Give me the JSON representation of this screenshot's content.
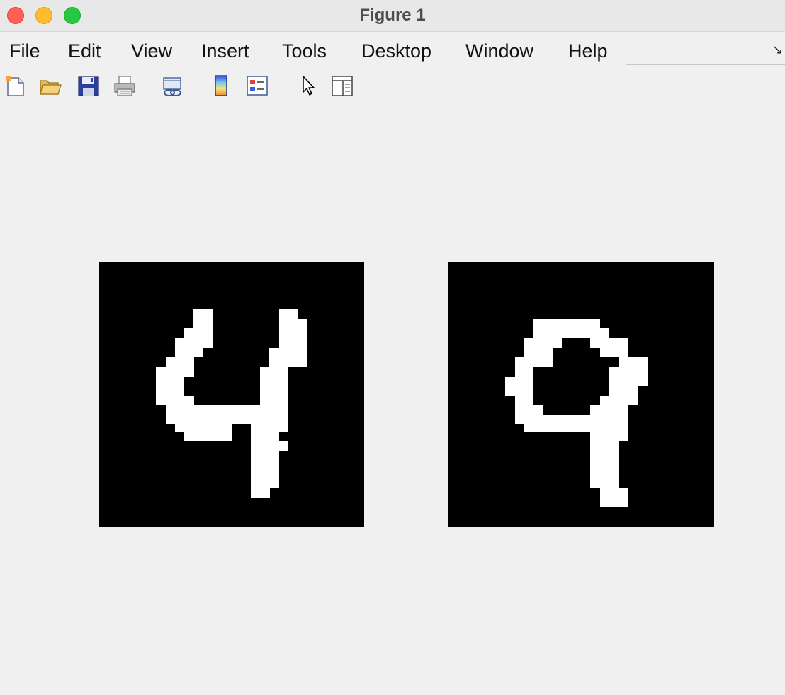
{
  "window": {
    "title": "Figure 1"
  },
  "menubar": {
    "items": [
      {
        "label": "File"
      },
      {
        "label": "Edit"
      },
      {
        "label": "View"
      },
      {
        "label": "Insert"
      },
      {
        "label": "Tools"
      },
      {
        "label": "Desktop"
      },
      {
        "label": "Window"
      },
      {
        "label": "Help"
      }
    ]
  },
  "toolbar": {
    "icons": [
      "new-figure-icon",
      "open-file-icon",
      "save-icon",
      "print-icon",
      "link-plot-icon",
      "colorbar-icon",
      "legend-icon",
      "edit-plot-pointer-icon",
      "property-inspector-icon"
    ]
  },
  "figure": {
    "images": [
      {
        "name": "digit-image-4",
        "colormap": "gray",
        "background": "#000000",
        "foreground": "#ffffff"
      },
      {
        "name": "digit-image-9",
        "colormap": "gray",
        "background": "#000000",
        "foreground": "#ffffff"
      }
    ]
  }
}
